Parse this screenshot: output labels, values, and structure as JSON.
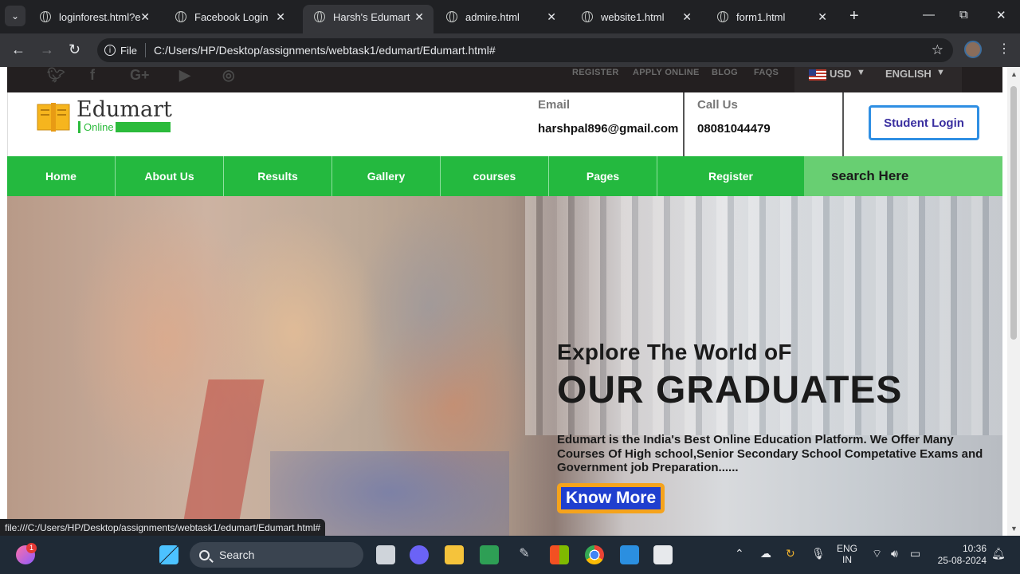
{
  "browser": {
    "tabs": [
      {
        "title": "loginforest.html?e",
        "active": false
      },
      {
        "title": "Facebook Login",
        "active": false
      },
      {
        "title": "Harsh's Edumart",
        "active": true
      },
      {
        "title": "admire.html",
        "active": false
      },
      {
        "title": "website1.html",
        "active": false
      },
      {
        "title": "form1.html",
        "active": false
      }
    ],
    "address_scheme": "File",
    "address_url": "C:/Users/HP/Desktop/assignments/webtask1/edumart/Edumart.html#",
    "status_url": "file:///C:/Users/HP/Desktop/assignments/webtask1/edumart/Edumart.html#"
  },
  "site": {
    "topbar": {
      "links": [
        "REGISTER",
        "APPLY ONLINE",
        "BLOG",
        "FAQS"
      ],
      "currency": "USD",
      "language": "ENGLISH"
    },
    "logo": {
      "name": "Edumart",
      "sub": "Online"
    },
    "contact": {
      "email_label": "Email",
      "email_value": "harshpal896@gmail.com",
      "phone_label": "Call Us",
      "phone_value": "08081044479"
    },
    "login_button": "Student Login",
    "nav": [
      "Home",
      "About Us",
      "Results",
      "Gallery",
      "courses",
      "Pages",
      "Register"
    ],
    "search_placeholder": "search Here",
    "hero": {
      "kicker": "Explore The World oF",
      "title": "OUR GRADUATES",
      "description": "Edumart is the India's Best Online Education Platform. We Offer Many Courses Of High school,Senior Secondary School Competative Exams and Government job Preparation......",
      "button": "Know More"
    }
  },
  "taskbar": {
    "search": "Search",
    "lang_top": "ENG",
    "lang_bottom": "IN",
    "time": "10:36",
    "date": "25-08-2024",
    "notification_count": "1"
  },
  "colors": {
    "nav_green": "#24b93f",
    "login_border": "#2f8fe3",
    "button_orange": "#f5a31c",
    "button_blue": "#1f3fcf"
  }
}
